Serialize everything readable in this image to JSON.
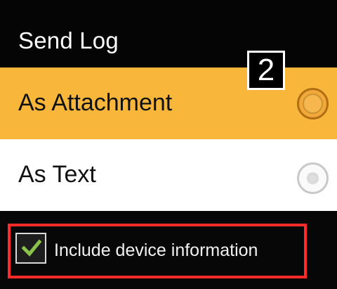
{
  "dialog": {
    "title": "Send Log",
    "step_badge": "2",
    "options": [
      {
        "label": "As Attachment",
        "selected": true
      },
      {
        "label": "As Text",
        "selected": false
      }
    ],
    "checkbox": {
      "label": "Include device information",
      "checked": true
    }
  },
  "colors": {
    "selected_row": "#f8b73a",
    "checkbox_mark": "#8bc34a",
    "annotation_outline": "#ff2a2a"
  },
  "icons": {
    "selected_option": "radio-selected-icon",
    "unselected_option": "radio-unselected-icon",
    "checkbox": "checkmark-icon"
  }
}
